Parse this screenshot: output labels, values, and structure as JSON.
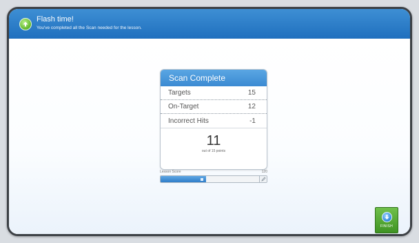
{
  "banner": {
    "title": "Flash time!",
    "subtitle": "You've completed all the Scan needed for the lesson."
  },
  "scan": {
    "title": "Scan Complete",
    "rows": [
      {
        "label": "Targets",
        "value": "15"
      },
      {
        "label": "On-Target",
        "value": "12"
      },
      {
        "label": "Incorrect Hits",
        "value": "-1"
      }
    ],
    "score": "11",
    "score_caption": "out of 15 points"
  },
  "progress": {
    "label": "Lesson Score",
    "max_label": "120",
    "fill_fraction": 0.46
  },
  "finish": {
    "label": "FINISH"
  },
  "colors": {
    "banner": "#1f6fbe",
    "finish": "#4ea12f"
  }
}
